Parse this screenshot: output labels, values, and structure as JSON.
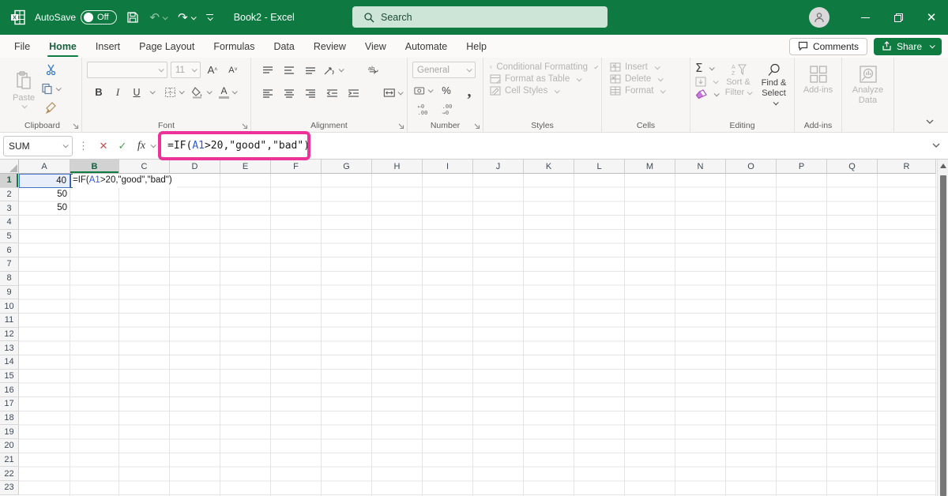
{
  "titlebar": {
    "autosave_label": "AutoSave",
    "autosave_state": "Off",
    "document_title": "Book2 - Excel",
    "search_placeholder": "Search"
  },
  "menu": {
    "tabs": [
      {
        "label": "File",
        "active": false
      },
      {
        "label": "Home",
        "active": true
      },
      {
        "label": "Insert",
        "active": false
      },
      {
        "label": "Page Layout",
        "active": false
      },
      {
        "label": "Formulas",
        "active": false
      },
      {
        "label": "Data",
        "active": false
      },
      {
        "label": "Review",
        "active": false
      },
      {
        "label": "View",
        "active": false
      },
      {
        "label": "Automate",
        "active": false
      },
      {
        "label": "Help",
        "active": false
      }
    ],
    "comments_label": "Comments",
    "share_label": "Share"
  },
  "ribbon": {
    "clipboard": {
      "label": "Clipboard",
      "paste": "Paste"
    },
    "font": {
      "label": "Font",
      "size": "11",
      "bold": "B",
      "italic": "I",
      "underline": "U"
    },
    "alignment": {
      "label": "Alignment"
    },
    "number": {
      "label": "Number",
      "format": "General",
      "percent": "%",
      "comma": ","
    },
    "styles": {
      "label": "Styles",
      "items": [
        "Conditional Formatting",
        "Format as Table",
        "Cell Styles"
      ]
    },
    "cells": {
      "label": "Cells",
      "items": [
        "Insert",
        "Delete",
        "Format"
      ]
    },
    "editing": {
      "label": "Editing",
      "autosum": "Σ",
      "sort_filter_1": "Sort &",
      "sort_filter_2": "Filter",
      "find_select_1": "Find &",
      "find_select_2": "Select"
    },
    "addins": {
      "label": "Add-ins",
      "button": "Add-ins"
    },
    "analyze": {
      "line1": "Analyze",
      "line2": "Data"
    }
  },
  "formula_bar": {
    "name_box": "SUM",
    "fx_label": "fx",
    "formula": {
      "prefix": "=IF(",
      "ref": "A1",
      "suffix": ">20,\"good\",\"bad\")"
    }
  },
  "grid": {
    "columns": [
      "A",
      "B",
      "C",
      "D",
      "E",
      "F",
      "G",
      "H",
      "I",
      "J",
      "K",
      "L",
      "M",
      "N",
      "O",
      "P",
      "Q",
      "R"
    ],
    "row_count": 23,
    "selected_column": "B",
    "selected_row": 1,
    "cells": [
      {
        "col": "A",
        "row": 1,
        "value": "40",
        "highlight": "reference"
      },
      {
        "col": "A",
        "row": 2,
        "value": "50"
      },
      {
        "col": "A",
        "row": 3,
        "value": "50"
      }
    ],
    "edit_cell": {
      "col": "B",
      "row": 1,
      "prefix": "=IF(",
      "ref": "A1",
      "suffix": ">20,\"good\",\"bad\")"
    }
  },
  "colors": {
    "title_green": "#0E7A41",
    "accent_green": "#107C41",
    "annotation_pink": "#EC3399",
    "reference_blue": "#2F5BD1",
    "reference_fill": "#E9EFFA",
    "reference_border": "#4472C4"
  }
}
